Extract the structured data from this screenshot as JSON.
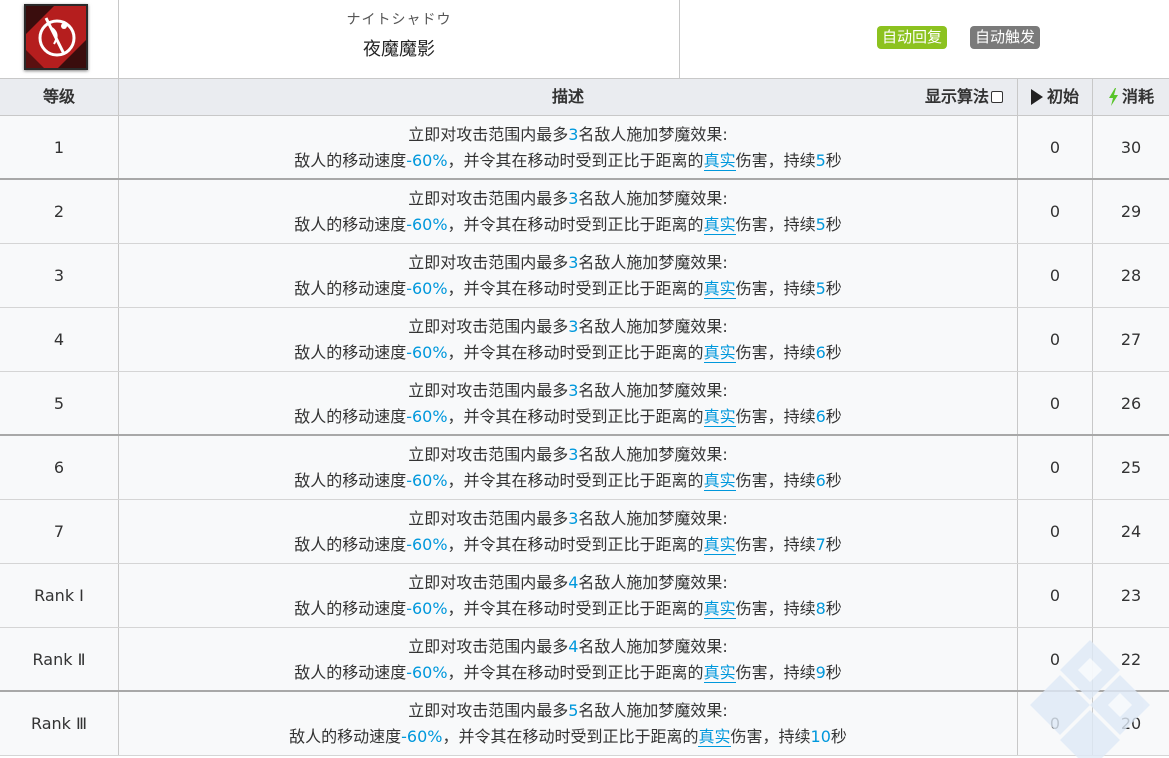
{
  "skill": {
    "jp_name": "ナイトシャドウ",
    "cn_name": "夜魔魔影",
    "tags": [
      "自动回复",
      "自动触发"
    ]
  },
  "columns": {
    "level": "等级",
    "desc": "描述",
    "formula": "显示算法",
    "init": "初始",
    "cost": "消耗"
  },
  "desc_parts": {
    "line1_a": "立即对攻击范围内最多",
    "line1_b": "名敌人施加梦魔效果:",
    "line2_a": "敌人的移动速度",
    "line2_speed": "-60%",
    "line2_b": "，并令其在移动时受到正比于距离的",
    "line2_true": "真实",
    "line2_c": "伤害，持续",
    "line2_d": "秒"
  },
  "rows": [
    {
      "level": "1",
      "targets": "3",
      "duration": "5",
      "init": "0",
      "cost": "30"
    },
    {
      "level": "2",
      "targets": "3",
      "duration": "5",
      "init": "0",
      "cost": "29"
    },
    {
      "level": "3",
      "targets": "3",
      "duration": "5",
      "init": "0",
      "cost": "28"
    },
    {
      "level": "4",
      "targets": "3",
      "duration": "6",
      "init": "0",
      "cost": "27"
    },
    {
      "level": "5",
      "targets": "3",
      "duration": "6",
      "init": "0",
      "cost": "26"
    },
    {
      "level": "6",
      "targets": "3",
      "duration": "6",
      "init": "0",
      "cost": "25"
    },
    {
      "level": "7",
      "targets": "3",
      "duration": "7",
      "init": "0",
      "cost": "24"
    },
    {
      "level": "Rank Ⅰ",
      "targets": "4",
      "duration": "8",
      "init": "0",
      "cost": "23"
    },
    {
      "level": "Rank Ⅱ",
      "targets": "4",
      "duration": "9",
      "init": "0",
      "cost": "22"
    },
    {
      "level": "Rank Ⅲ",
      "targets": "5",
      "duration": "10",
      "init": "0",
      "cost": "20"
    }
  ],
  "colors": {
    "accent": "#0098dc",
    "tag_green": "#8cc21f",
    "tag_grey": "#7a7a7a",
    "bolt": "#58c42a"
  }
}
